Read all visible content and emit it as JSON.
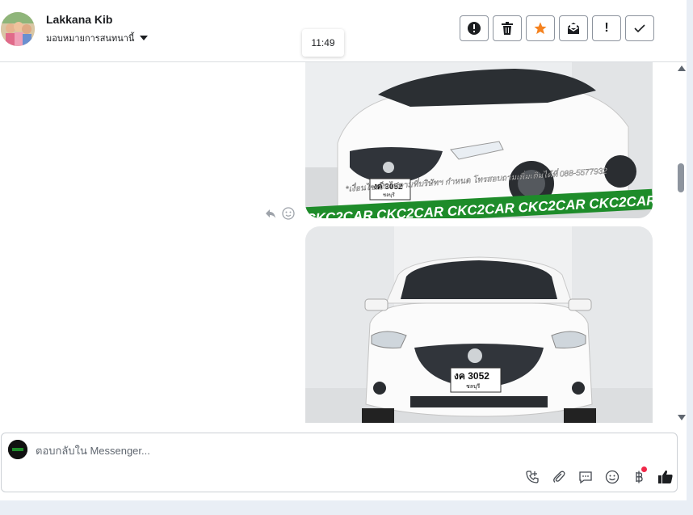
{
  "header": {
    "contact_name": "Lakkana Kib",
    "assign_label": "มอบหมายการสนทนานี้",
    "actions": [
      {
        "name": "spam-button",
        "icon": "exclamation-circle-icon",
        "glyph": "!"
      },
      {
        "name": "delete-button",
        "icon": "trash-icon",
        "glyph": ""
      },
      {
        "name": "star-button",
        "icon": "star-icon",
        "glyph": ""
      },
      {
        "name": "mark-unread-button",
        "icon": "envelope-icon",
        "glyph": ""
      },
      {
        "name": "follow-up-button",
        "icon": "exclamation-icon",
        "glyph": "!"
      },
      {
        "name": "mark-done-button",
        "icon": "check-icon",
        "glyph": ""
      }
    ]
  },
  "chat": {
    "timestamp": "11:49",
    "image1": {
      "plate": "งค 3052",
      "plate_sub": "ชลบุรี",
      "caption": "*เงื่อนไขเป็นไปตามที่บริษัทฯ กำหนด โทรสอบถามเพิ่มเติมได้ที่ 088-5577932",
      "banner": "CKC2CAR CKC2CAR CKC2CAR CKC2CAR CKC2CAR CKC2"
    },
    "image2": {
      "plate": "งค 3052",
      "plate_sub": "ชลบุรี"
    }
  },
  "composer": {
    "placeholder": "ตอบกลับใน Messenger...",
    "value": "",
    "tools": [
      "phone-plus-icon",
      "paperclip-icon",
      "saved-reply-icon",
      "emoji-icon",
      "baht-icon",
      "thumbs-up-icon"
    ]
  },
  "colors": {
    "star_accent": "#f5821f",
    "banner_green": "#1e8c2a",
    "notification_dot": "#f02849"
  }
}
